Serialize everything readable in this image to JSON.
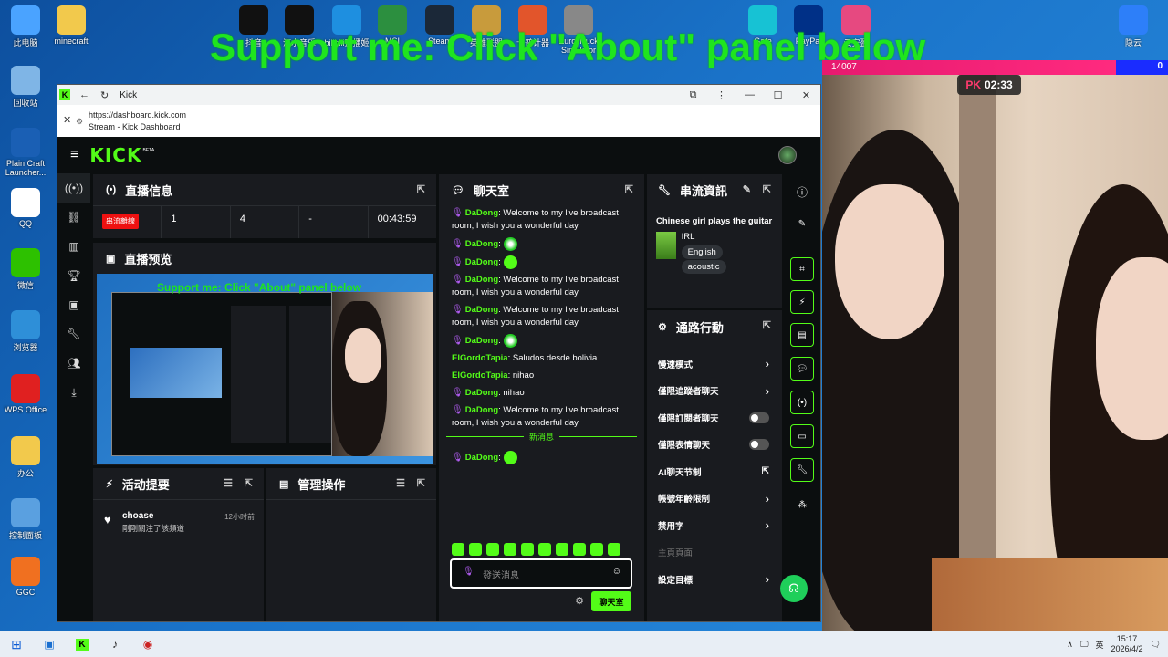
{
  "desktop": {
    "left_icons": [
      {
        "label": "此电脑",
        "icon": "computer-icon",
        "color": "#4aa3ff"
      },
      {
        "label": "回收站",
        "icon": "recycle-bin-icon",
        "color": "#7fb5e6"
      },
      {
        "label": "Plain Craft Launcher...",
        "icon": "pcl-icon",
        "color": "#1a5fb4"
      },
      {
        "label": "QQ",
        "icon": "qq-icon",
        "color": "#ffffff"
      },
      {
        "label": "微信",
        "icon": "wechat-icon",
        "color": "#2dc100"
      },
      {
        "label": "浏览器",
        "icon": "edge-icon",
        "color": "#2e8fd8"
      },
      {
        "label": "WPS Office",
        "icon": "wps-icon",
        "color": "#e02020"
      },
      {
        "label": "办公",
        "icon": "folder-icon",
        "color": "#f2c94c"
      },
      {
        "label": "控制面板",
        "icon": "control-panel-icon",
        "color": "#5aa0e0"
      },
      {
        "label": "GGC",
        "icon": "ggc-icon",
        "color": "#f07020"
      }
    ],
    "top_icons": [
      {
        "label": "minecraft",
        "icon": "folder-icon",
        "color": "#f2c94c"
      },
      {
        "label": "抖音",
        "icon": "tiktok-icon",
        "color": "#111111"
      },
      {
        "label": "汽水音乐",
        "icon": "music-icon",
        "color": "#111111"
      },
      {
        "label": "bilibili直播姬",
        "icon": "bilibili-icon",
        "color": "#1e8fe0"
      },
      {
        "label": "MSI",
        "icon": "msi-icon",
        "color": "#2c8f3f"
      },
      {
        "label": "Steam",
        "icon": "steam-icon",
        "color": "#1b2838"
      },
      {
        "label": "英雄联盟",
        "icon": "lol-icon",
        "color": "#c89b3c"
      },
      {
        "label": "卡普计器",
        "icon": "network-icon",
        "color": "#e2552b"
      },
      {
        "label": "Euro Truck Simulator",
        "icon": "truck-icon",
        "color": "#888888"
      },
      {
        "label": "Gate",
        "icon": "gate-icon",
        "color": "#17c2d4"
      },
      {
        "label": "PayPal",
        "icon": "paypal-icon",
        "color": "#003087"
      },
      {
        "label": "云安盈",
        "icon": "cloud-ring-icon",
        "color": "#e64980"
      },
      {
        "label": "隐云",
        "icon": "cloud-icon",
        "color": "#2d7ff9"
      }
    ],
    "overlay_text": "Support me: Click \"About\" panel below"
  },
  "browser": {
    "tab_title": "Kick",
    "url": "https://dashboard.kick.com",
    "page_title": "Stream - Kick Dashboard"
  },
  "kick": {
    "brand": "KICK",
    "beta": "BETA",
    "stream_info": {
      "title": "直播信息",
      "live_badge": "串流離線",
      "stats": [
        "1",
        "4",
        "-",
        "00:43:59"
      ]
    },
    "preview": {
      "title": "直播预览",
      "overlay_text": "Support me: Click \"About\" panel below"
    },
    "activity": {
      "title": "活动提要",
      "item_user": "choase",
      "item_text": "剛剛關注了該頻道",
      "item_time": "12小时前"
    },
    "mod_actions": {
      "title": "管理操作"
    },
    "chat": {
      "title": "聊天室",
      "messages": [
        {
          "user": "DaDong",
          "text": ": Welcome to my live broadcast room, I wish you a wonderful day",
          "badge": true,
          "emote": false
        },
        {
          "user": "DaDong",
          "text": ":",
          "badge": true,
          "emote": true
        },
        {
          "user": "DaDong",
          "text": ":",
          "badge": true,
          "emote": true
        },
        {
          "user": "DaDong",
          "text": ": Welcome to my live broadcast room, I wish you a wonderful day",
          "badge": true,
          "emote": false
        },
        {
          "user": "DaDong",
          "text": ": Welcome to my live broadcast room, I wish you a wonderful day",
          "badge": true,
          "emote": false
        },
        {
          "user": "DaDong",
          "text": ":",
          "badge": true,
          "emote": true
        },
        {
          "user": "ElGordoTapia",
          "text": ": Saludos desde bolivia",
          "badge": false,
          "emote": false
        },
        {
          "user": "ElGordoTapia",
          "text": ": nihao",
          "badge": false,
          "emote": false
        },
        {
          "user": "DaDong",
          "text": ": nihao",
          "badge": true,
          "emote": false
        },
        {
          "user": "DaDong",
          "text": ": Welcome to my live broadcast room, I wish you a wonderful day",
          "badge": true,
          "emote": false
        }
      ],
      "new_messages_label": "新消息",
      "after_messages": [
        {
          "user": "DaDong",
          "text": ":",
          "badge": true,
          "emote": true
        }
      ],
      "input_placeholder": "發送消息",
      "send_label": "聊天室"
    },
    "stream_details": {
      "title": "串流資訊",
      "stream_title": "Chinese girl plays the guitar",
      "category": "IRL",
      "tags": [
        "English",
        "acoustic"
      ]
    },
    "shortcuts": {
      "title": "通路行動",
      "items": [
        {
          "label": "慢速模式",
          "control": "arrow"
        },
        {
          "label": "僅限追蹤者聊天",
          "control": "arrow"
        },
        {
          "label": "僅限訂閱者聊天",
          "control": "toggle"
        },
        {
          "label": "僅限表情聊天",
          "control": "toggle"
        },
        {
          "label": "AI聊天节制",
          "control": "external"
        },
        {
          "label": "帳號年齡限制",
          "control": "arrow"
        },
        {
          "label": "禁用字",
          "control": "arrow"
        },
        {
          "label": "主頁頁面",
          "control": "none"
        },
        {
          "label": "設定目標",
          "control": "arrow"
        }
      ]
    }
  },
  "camera": {
    "score_left": "14007",
    "score_right": "0",
    "pk_label": "PK",
    "pk_timer": "02:33"
  },
  "taskbar": {
    "lang": "英",
    "time": "15:17",
    "date": "2026/4/2"
  },
  "colors": {
    "kick_green": "#53fc18",
    "panel_bg": "#191b1f",
    "page_bg": "#0b0e0f"
  }
}
